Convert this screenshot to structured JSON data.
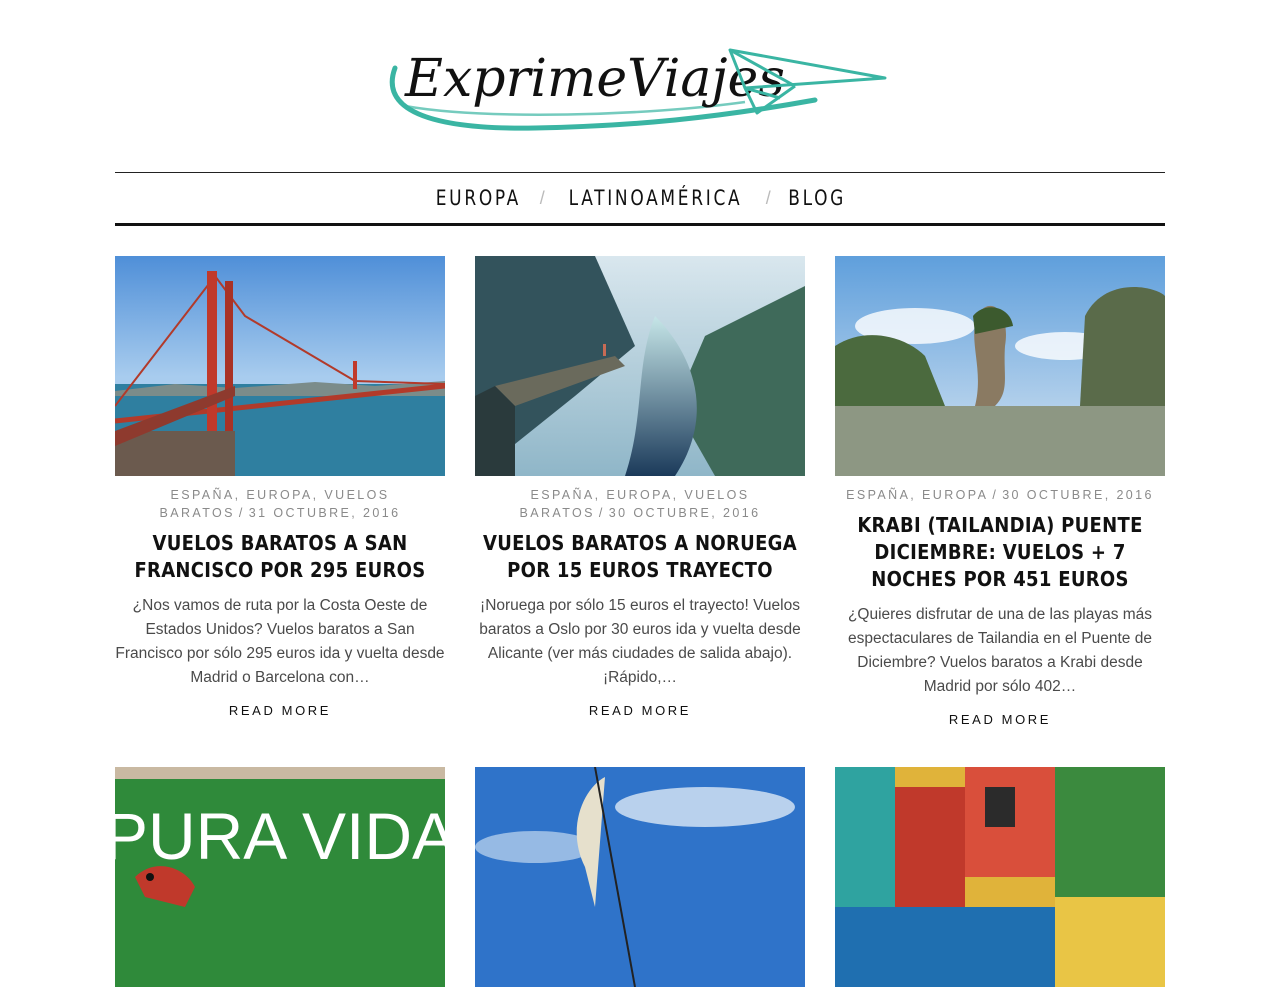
{
  "site": {
    "logo_text": "ExprimeViajes",
    "accent": "#3ab5a3"
  },
  "nav": {
    "items": [
      "EUROPA",
      "LATINOAMÉRICA",
      "BLOG"
    ]
  },
  "posts": [
    {
      "categories": "ESPAÑA, EUROPA, VUELOS BARATOS",
      "date": "31 OCTUBRE, 2016",
      "title": "VUELOS BARATOS A SAN FRANCISCO POR 295 EUROS",
      "excerpt": "¿Nos vamos de ruta por la Costa Oeste de Estados Unidos? Vuelos baratos a San Francisco por sólo 295 euros ida y vuelta desde Madrid o Barcelona con…",
      "read_more": "READ MORE"
    },
    {
      "categories": "ESPAÑA, EUROPA, VUELOS BARATOS",
      "date": "30 OCTUBRE, 2016",
      "title": "VUELOS BARATOS A NORUEGA POR 15 EUROS TRAYECTO",
      "excerpt": "¡Noruega por sólo 15 euros el trayecto! Vuelos baratos a Oslo por 30 euros ida y vuelta desde Alicante (ver más ciudades de salida abajo). ¡Rápido,…",
      "read_more": "READ MORE"
    },
    {
      "categories": "ESPAÑA, EUROPA",
      "date": "30 OCTUBRE, 2016",
      "title": "KRABI (TAILANDIA) PUENTE DICIEMBRE: VUELOS + 7 NOCHES POR 451 EUROS",
      "excerpt": "¿Quieres disfrutar de una de las playas más espectaculares de Tailandia en el Puente de Diciembre? Vuelos baratos a Krabi desde Madrid por sólo 402…",
      "read_more": "READ MORE"
    }
  ],
  "row2": {
    "sign_text": "PURA VIDA"
  }
}
